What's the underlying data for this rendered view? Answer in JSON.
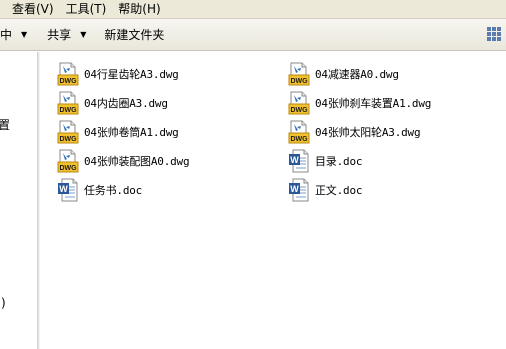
{
  "menubar": {
    "items": [
      "查看(V)",
      "工具(T)",
      "帮助(H)"
    ]
  },
  "toolbar": {
    "organize_label": "库中",
    "share_label": "共享",
    "new_folder_label": "新建文件夹",
    "view_icon": "view-options-icon"
  },
  "navpane": {
    "items": [
      "装置",
      ")"
    ]
  },
  "files": [
    {
      "name": "04行星齿轮A3.dwg",
      "type": "dwg"
    },
    {
      "name": "04减速器A0.dwg",
      "type": "dwg"
    },
    {
      "name": "04内齿圈A3.dwg",
      "type": "dwg"
    },
    {
      "name": "04张帅刹车装置A1.dwg",
      "type": "dwg"
    },
    {
      "name": "04张帅卷筒A1.dwg",
      "type": "dwg"
    },
    {
      "name": "04张帅太阳轮A3.dwg",
      "type": "dwg"
    },
    {
      "name": "04张帅装配图A0.dwg",
      "type": "dwg"
    },
    {
      "name": "目录.doc",
      "type": "doc"
    },
    {
      "name": "任务书.doc",
      "type": "doc"
    },
    {
      "name": "正文.doc",
      "type": "doc"
    }
  ],
  "icon_labels": {
    "dwg": "DWG",
    "doc": "W"
  },
  "colors": {
    "menubar_bg": "#ece9d8",
    "dwg_yellow": "#f2c12e",
    "doc_blue": "#2b5797"
  }
}
